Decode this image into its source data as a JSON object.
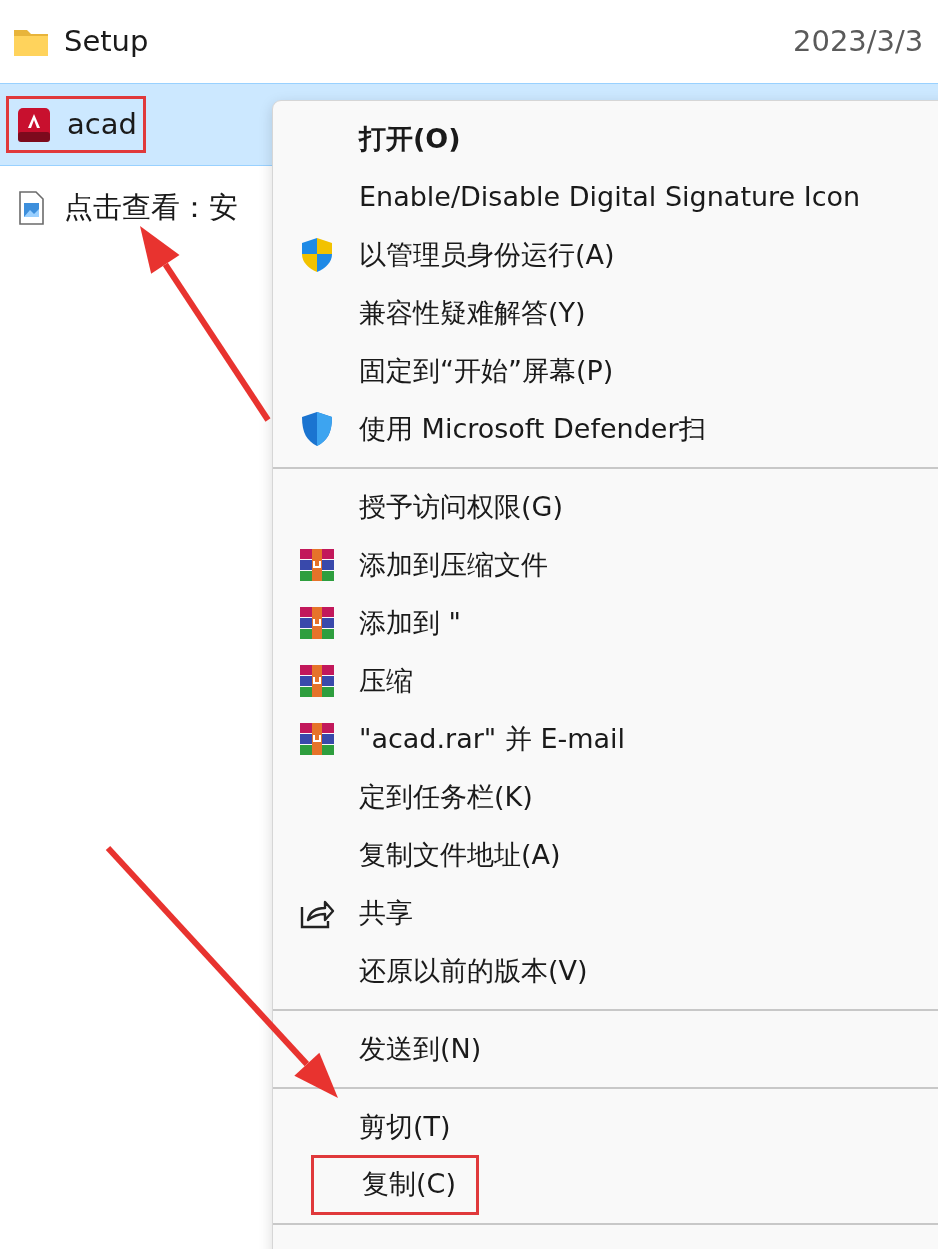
{
  "files": [
    {
      "kind": "folder",
      "name": "Setup",
      "date": "2023/3/3",
      "selected": false,
      "highlighted": false
    },
    {
      "kind": "app",
      "name": "acad",
      "selected": true,
      "highlighted": true
    },
    {
      "kind": "image",
      "name": "点击查看：安",
      "selected": false,
      "highlighted": false
    }
  ],
  "context_menu": {
    "items": [
      {
        "kind": "plain",
        "label": "打开(O)",
        "default": true,
        "highlighted": false
      },
      {
        "kind": "plain",
        "label": "Enable/Disable Digital Signature Icon",
        "default": false,
        "highlighted": false
      },
      {
        "kind": "uac",
        "label": "以管理员身份运行(A)",
        "default": false,
        "highlighted": false
      },
      {
        "kind": "plain",
        "label": "兼容性疑难解答(Y)",
        "default": false,
        "highlighted": false
      },
      {
        "kind": "plain",
        "label": "固定到“开始”屏幕(P)",
        "default": false,
        "highlighted": false
      },
      {
        "kind": "defender",
        "label": "使用 Microsoft Defender扫",
        "default": false,
        "highlighted": false
      },
      {
        "kind": "separator"
      },
      {
        "kind": "plain",
        "label": "授予访问权限(G)",
        "default": false,
        "highlighted": false
      },
      {
        "kind": "archive",
        "label": "添加到压缩文件",
        "default": false,
        "highlighted": false
      },
      {
        "kind": "archive",
        "label": "添加到 \"",
        "default": false,
        "highlighted": false
      },
      {
        "kind": "archive",
        "label": "压缩",
        "default": false,
        "highlighted": false
      },
      {
        "kind": "archive",
        "label": "\"acad.rar\" 并 E-mail",
        "default": false,
        "highlighted": false
      },
      {
        "kind": "plain",
        "label": "定到任务栏(K)",
        "default": false,
        "highlighted": false
      },
      {
        "kind": "plain",
        "label": "复制文件地址(A)",
        "default": false,
        "highlighted": false
      },
      {
        "kind": "share",
        "label": "共享",
        "default": false,
        "highlighted": false
      },
      {
        "kind": "plain",
        "label": "还原以前的版本(V)",
        "default": false,
        "highlighted": false
      },
      {
        "kind": "separator"
      },
      {
        "kind": "plain",
        "label": "发送到(N)",
        "default": false,
        "highlighted": false
      },
      {
        "kind": "separator"
      },
      {
        "kind": "plain",
        "label": "剪切(T)",
        "default": false,
        "highlighted": false
      },
      {
        "kind": "plain",
        "label": "复制(C)",
        "default": false,
        "highlighted": true
      },
      {
        "kind": "separator"
      }
    ]
  },
  "annotations": [
    {
      "kind": "arrow"
    },
    {
      "kind": "arrow"
    }
  ]
}
